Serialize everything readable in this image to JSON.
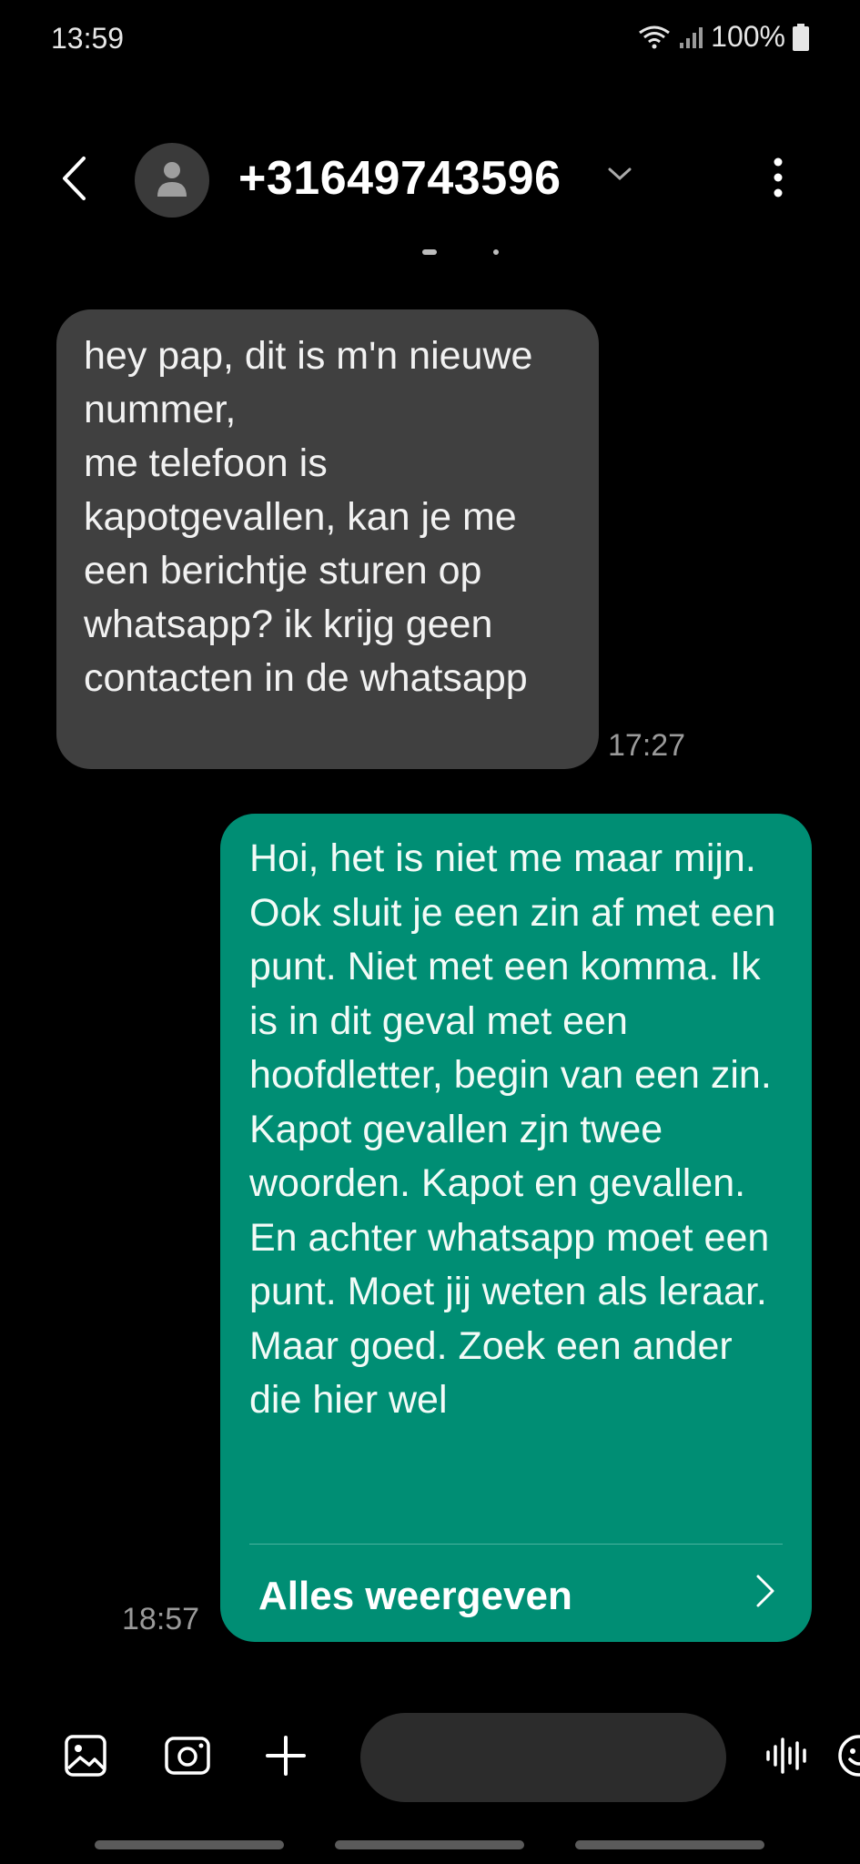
{
  "status_bar": {
    "time": "13:59",
    "battery": "100%"
  },
  "header": {
    "contact": "+31649743596",
    "back_icon": "chevron-left-icon",
    "avatar_icon": "person-icon",
    "expand_icon": "chevron-down-icon",
    "more_icon": "more-vertical-icon"
  },
  "messages": [
    {
      "direction": "incoming",
      "text": "hey pap, dit is m'n nieuwe nummer,\nme telefoon is kapotgevallen, kan je me een berichtje sturen op whatsapp? ik krijg geen contacten in de whatsapp",
      "time": "17:27"
    },
    {
      "direction": "outgoing",
      "text": "Hoi, het is niet me maar mijn. Ook sluit je een zin af met een punt. Niet met een komma. Ik is in dit geval met een hoofdletter, begin van een zin. Kapot gevallen zjn twee woorden. Kapot en gevallen. En achter whatsapp moet een punt. Moet jij weten als leraar. Maar goed. Zoek een ander die hier wel",
      "time": "18:57",
      "show_all_label": "Alles weergeven"
    }
  ],
  "compose": {
    "placeholder": "",
    "icons": [
      "gallery-icon",
      "camera-icon",
      "plus-icon",
      "emoji-icon",
      "voice-icon"
    ]
  },
  "colors": {
    "background": "#000000",
    "incoming_bubble": "#404040",
    "outgoing_bubble": "#008e74",
    "timestamp": "#9a9a9a"
  }
}
